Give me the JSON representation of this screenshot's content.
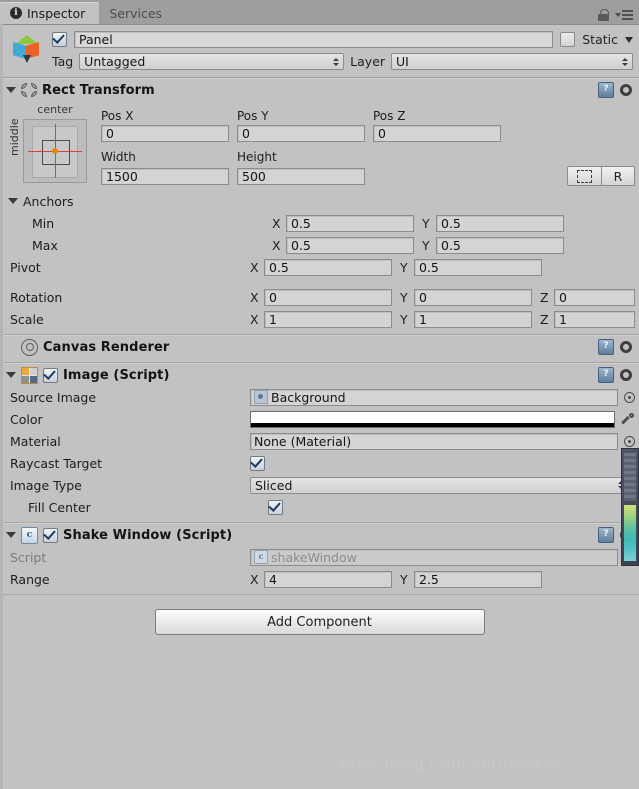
{
  "window": {
    "tabs": [
      {
        "label": "Inspector",
        "icon": "info-icon",
        "active": true
      },
      {
        "label": "Services",
        "icon": "",
        "active": false
      }
    ],
    "lock_icon": "lock-icon",
    "menu_icon": "menu-icon"
  },
  "gameobject": {
    "icon": "prefab-cube-icon",
    "enabled_checkbox": true,
    "name": "Panel",
    "static_label": "Static",
    "static_checkbox": false,
    "tag_label": "Tag",
    "tag_value": "Untagged",
    "layer_label": "Layer",
    "layer_value": "UI"
  },
  "components": {
    "rect_transform": {
      "title": "Rect Transform",
      "icon": "rect-transform-icon",
      "anchor_preset": {
        "top_label": "center",
        "left_label": "middle"
      },
      "pos_labels": [
        "Pos X",
        "Pos Y",
        "Pos Z"
      ],
      "pos_values": [
        "0",
        "0",
        "0"
      ],
      "size_labels": [
        "Width",
        "Height"
      ],
      "size_values": [
        "1500",
        "500"
      ],
      "blueprint_button": "blueprint-mode-icon",
      "raw_button": "R",
      "anchors_label": "Anchors",
      "anchors": [
        {
          "label": "Min",
          "x": "0.5",
          "y": "0.5"
        },
        {
          "label": "Max",
          "x": "0.5",
          "y": "0.5"
        }
      ],
      "pivot": {
        "label": "Pivot",
        "x": "0.5",
        "y": "0.5"
      },
      "rotation": {
        "label": "Rotation",
        "x": "0",
        "y": "0",
        "z": "0"
      },
      "scale": {
        "label": "Scale",
        "x": "1",
        "y": "1",
        "z": "1"
      },
      "axis_x": "X",
      "axis_y": "Y",
      "axis_z": "Z"
    },
    "canvas_renderer": {
      "title": "Canvas Renderer",
      "icon": "canvas-renderer-icon"
    },
    "image": {
      "title": "Image (Script)",
      "icon": "image-script-icon",
      "enabled_checkbox": true,
      "rows": {
        "source_image": {
          "label": "Source Image",
          "value": "Background"
        },
        "color": {
          "label": "Color",
          "value": "#FFFFFF",
          "alpha": "#000000"
        },
        "material": {
          "label": "Material",
          "value": "None (Material)"
        },
        "raycast_target": {
          "label": "Raycast Target",
          "checked": true
        },
        "image_type": {
          "label": "Image Type",
          "value": "Sliced"
        },
        "fill_center": {
          "label": "Fill Center",
          "checked": true
        }
      }
    },
    "shake_window": {
      "title": "Shake Window (Script)",
      "icon": "cs-script-icon",
      "enabled_checkbox": true,
      "script_label": "Script",
      "script_value": "shakeWindow",
      "range_label": "Range",
      "range_x": "4",
      "range_y": "2.5",
      "axis_x": "X",
      "axis_y": "Y"
    }
  },
  "footer": {
    "add_component_label": "Add Component",
    "watermark": "http://blog.csdn.net/marcvsi"
  },
  "colors": {
    "background": "#C2C2C2",
    "tabbar": "#9E9E9E",
    "field": "#D4D4D4",
    "checkbox_accent": "#1A3B63",
    "anchor_cross": "#E03C3C",
    "pivot_dot": "#E08A18"
  }
}
